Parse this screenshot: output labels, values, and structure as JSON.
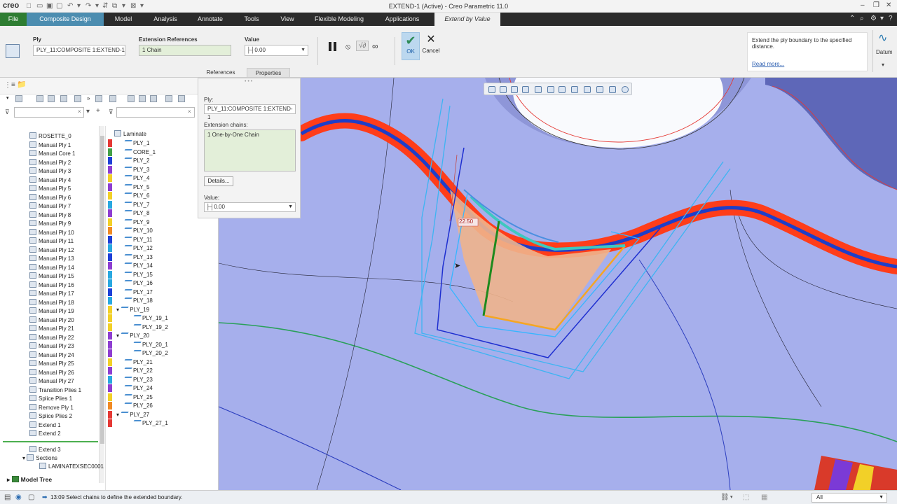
{
  "app": {
    "logo": "creo",
    "title": "EXTEND-1 (Active) - Creo Parametric 11.0"
  },
  "tabs": [
    {
      "label": "File"
    },
    {
      "label": "Composite Design"
    },
    {
      "label": "Model"
    },
    {
      "label": "Analysis"
    },
    {
      "label": "Annotate"
    },
    {
      "label": "Tools"
    },
    {
      "label": "View"
    },
    {
      "label": "Flexible Modeling"
    },
    {
      "label": "Applications"
    },
    {
      "label": "Extend by Value"
    }
  ],
  "ribbon": {
    "ply_label": "Ply",
    "ply_value": "PLY_11:COMPOSITE 1:EXTEND-1",
    "extref_label": "Extension References",
    "extref_value": "1 Chain",
    "value_label": "Value",
    "value_value": "0.00",
    "ok_label": "OK",
    "cancel_label": "Cancel",
    "subtab_references": "References",
    "subtab_properties": "Properties",
    "datum_label": "Datum"
  },
  "info": {
    "text": "Extend the ply boundary to the specified distance.",
    "link": "Read more..."
  },
  "flyout": {
    "ply_label": "Ply:",
    "ply_value": "PLY_11:COMPOSITE 1:EXTEND-1",
    "chains_label": "Extension chains:",
    "chains_value": "1 One-by-One Chain",
    "details_button": "Details...",
    "value_label": "Value:",
    "value_value": "0.00"
  },
  "model_tree": {
    "items": [
      {
        "label": "ROSETTE_0"
      },
      {
        "label": "Manual Ply 1"
      },
      {
        "label": "Manual Core 1"
      },
      {
        "label": "Manual Ply 2"
      },
      {
        "label": "Manual Ply 3"
      },
      {
        "label": "Manual Ply 4"
      },
      {
        "label": "Manual Ply 5"
      },
      {
        "label": "Manual Ply 6"
      },
      {
        "label": "Manual Ply 7"
      },
      {
        "label": "Manual Ply 8"
      },
      {
        "label": "Manual Ply 9"
      },
      {
        "label": "Manual Ply 10"
      },
      {
        "label": "Manual Ply 11"
      },
      {
        "label": "Manual Ply 12"
      },
      {
        "label": "Manual Ply 13"
      },
      {
        "label": "Manual Ply 14"
      },
      {
        "label": "Manual Ply 15"
      },
      {
        "label": "Manual Ply 16"
      },
      {
        "label": "Manual Ply 17"
      },
      {
        "label": "Manual Ply 18"
      },
      {
        "label": "Manual Ply 19"
      },
      {
        "label": "Manual Ply 20"
      },
      {
        "label": "Manual Ply 21"
      },
      {
        "label": "Manual Ply 22"
      },
      {
        "label": "Manual Ply 23"
      },
      {
        "label": "Manual Ply 24"
      },
      {
        "label": "Manual Ply 25"
      },
      {
        "label": "Manual Ply 26"
      },
      {
        "label": "Manual Ply 27"
      },
      {
        "label": "Transition Plies 1"
      },
      {
        "label": "Splice Plies 1"
      },
      {
        "label": "Remove Ply 1"
      },
      {
        "label": "Splice Plies 2"
      },
      {
        "label": "Extend 1"
      },
      {
        "label": "Extend 2"
      }
    ],
    "after_insert": [
      {
        "label": "Extend 3"
      },
      {
        "label": "Sections"
      },
      {
        "label": "LAMINATEXSEC0001"
      }
    ],
    "footer": "Model Tree"
  },
  "laminate": {
    "root": "Laminate",
    "items": [
      {
        "label": "PLY_1",
        "color": "#e53935"
      },
      {
        "label": "CORE_1",
        "color": "#43a047"
      },
      {
        "label": "PLY_2",
        "color": "#1e40d8"
      },
      {
        "label": "PLY_3",
        "color": "#8e3ed1"
      },
      {
        "label": "PLY_4",
        "color": "#f2d028"
      },
      {
        "label": "PLY_5",
        "color": "#8e3ed1"
      },
      {
        "label": "PLY_6",
        "color": "#f2d028"
      },
      {
        "label": "PLY_7",
        "color": "#29a8e0"
      },
      {
        "label": "PLY_8",
        "color": "#8e3ed1"
      },
      {
        "label": "PLY_9",
        "color": "#f2d028"
      },
      {
        "label": "PLY_10",
        "color": "#f08a24"
      },
      {
        "label": "PLY_11",
        "color": "#1e40d8"
      },
      {
        "label": "PLY_12",
        "color": "#29a8e0"
      },
      {
        "label": "PLY_13",
        "color": "#1e40d8"
      },
      {
        "label": "PLY_14",
        "color": "#8e3ed1"
      },
      {
        "label": "PLY_15",
        "color": "#29a8e0"
      },
      {
        "label": "PLY_16",
        "color": "#29a8e0"
      },
      {
        "label": "PLY_17",
        "color": "#1e40d8"
      },
      {
        "label": "PLY_18",
        "color": "#29a8e0"
      },
      {
        "label": "PLY_19",
        "color": "#f2d028"
      },
      {
        "label": "PLY_19_1",
        "color": "#f2d028"
      },
      {
        "label": "PLY_19_2",
        "color": "#f2d028"
      },
      {
        "label": "PLY_20",
        "color": "#8e3ed1"
      },
      {
        "label": "PLY_20_1",
        "color": "#8e3ed1"
      },
      {
        "label": "PLY_20_2",
        "color": "#8e3ed1"
      },
      {
        "label": "PLY_21",
        "color": "#f2d028"
      },
      {
        "label": "PLY_22",
        "color": "#8e3ed1"
      },
      {
        "label": "PLY_23",
        "color": "#29a8e0"
      },
      {
        "label": "PLY_24",
        "color": "#8e3ed1"
      },
      {
        "label": "PLY_25",
        "color": "#f2d028"
      },
      {
        "label": "PLY_26",
        "color": "#f08a24"
      },
      {
        "label": "PLY_27",
        "color": "#e53935"
      },
      {
        "label": "PLY_27_1",
        "color": "#e53935"
      }
    ]
  },
  "viewport": {
    "dimension_label": "22.50"
  },
  "status": {
    "message": "13:09 Select chains to define the extended boundary.",
    "filter_value": "All"
  }
}
